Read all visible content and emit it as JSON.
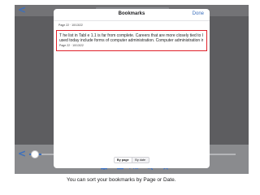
{
  "reader": {
    "back_glyph": "<",
    "bottom_back_glyph": "<",
    "progress_fraction": 0.06,
    "toolbar_icons": [
      "book-icon",
      "list-icon",
      "font-size-icon",
      "search-icon",
      "bookmark-icon"
    ],
    "font_label": "Aa",
    "accent_color": "#3b6fbd"
  },
  "modal": {
    "title": "Bookmarks",
    "done_label": "Done",
    "bookmarks": [
      {
        "meta": "Page 22 · 10/13/22"
      },
      {
        "excerpt_line1": "T he list in Tabl e 1.1 is far from complete. Careers that are more closely tied to IT as it is",
        "excerpt_line2": "used today include forms of computer administration. Computer administration includ..",
        "meta": "Page 22 · 10/13/22",
        "highlight_color": "#e0202a"
      }
    ],
    "sort_options": [
      "By page",
      "By date"
    ],
    "sort_selected": "By page"
  },
  "caption": "You can sort your bookmarks by Page or Date."
}
